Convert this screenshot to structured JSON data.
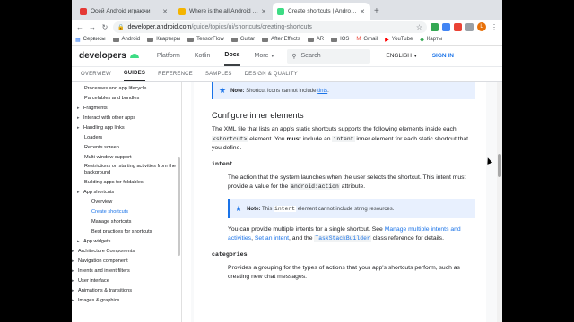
{
  "tabs": [
    {
      "title": "Осей Android играючи",
      "favicon_color": "#e53935",
      "active": false
    },
    {
      "title": "Where is the all Android broad",
      "favicon_color": "#f4b400",
      "active": false
    },
    {
      "title": "Create shortcuts | Android De",
      "favicon_color": "#3ddc84",
      "active": true
    }
  ],
  "toolbar": {
    "url_host": "developer.android.com",
    "url_path": "/guide/topics/ui/shortcuts/creating-shortcuts",
    "avatar_letter": "L"
  },
  "bookmarks": [
    {
      "label": "Сервисы",
      "icon": "apps-icon"
    },
    {
      "label": "Android",
      "icon": "folder-icon"
    },
    {
      "label": "Квартиры",
      "icon": "folder-icon"
    },
    {
      "label": "TensorFlow",
      "icon": "folder-icon"
    },
    {
      "label": "Guitar",
      "icon": "folder-icon"
    },
    {
      "label": "After Effects",
      "icon": "folder-icon"
    },
    {
      "label": "AR",
      "icon": "folder-icon"
    },
    {
      "label": "IOS",
      "icon": "folder-icon"
    },
    {
      "label": "Gmail",
      "icon": "gmail-icon"
    },
    {
      "label": "YouTube",
      "icon": "youtube-icon"
    },
    {
      "label": "Карты",
      "icon": "maps-icon"
    }
  ],
  "site": {
    "logo": "developers",
    "nav": [
      "Platform",
      "Kotlin",
      "Docs",
      "More"
    ],
    "search_placeholder": "Search",
    "language": "ENGLISH",
    "signin": "SIGN IN"
  },
  "subnav": [
    "OVERVIEW",
    "GUIDES",
    "REFERENCE",
    "SAMPLES",
    "DESIGN & QUALITY"
  ],
  "sidebar": [
    {
      "label": "Processes and app lifecycle",
      "chevron": false,
      "indent": 2
    },
    {
      "label": "Parcelables and bundles",
      "chevron": false,
      "indent": 2
    },
    {
      "label": "Fragments",
      "chevron": true,
      "indent": 1
    },
    {
      "label": "Interact with other apps",
      "chevron": true,
      "indent": 1
    },
    {
      "label": "Handling app links",
      "chevron": true,
      "indent": 1
    },
    {
      "label": "Loaders",
      "chevron": false,
      "indent": 2
    },
    {
      "label": "Recents screen",
      "chevron": false,
      "indent": 2
    },
    {
      "label": "Multi-window support",
      "chevron": false,
      "indent": 2
    },
    {
      "label": "Restrictions on starting activities from the background",
      "chevron": false,
      "indent": 2
    },
    {
      "label": "Building apps for foldables",
      "chevron": false,
      "indent": 2
    },
    {
      "label": "App shortcuts",
      "chevron": true,
      "indent": 1
    },
    {
      "label": "Overview",
      "chevron": false,
      "indent": 3
    },
    {
      "label": "Create shortcuts",
      "chevron": false,
      "indent": 3,
      "selected": true
    },
    {
      "label": "Manage shortcuts",
      "chevron": false,
      "indent": 3
    },
    {
      "label": "Best practices for shortcuts",
      "chevron": false,
      "indent": 3
    },
    {
      "label": "App widgets",
      "chevron": true,
      "indent": 1
    },
    {
      "label": "Architecture Components",
      "chevron": true,
      "indent": 0
    },
    {
      "label": "Navigation component",
      "chevron": true,
      "indent": 0
    },
    {
      "label": "Intents and intent filters",
      "chevron": true,
      "indent": 0
    },
    {
      "label": "User interface",
      "chevron": true,
      "indent": 0
    },
    {
      "label": "Animations & transitions",
      "chevron": true,
      "indent": 0
    },
    {
      "label": "Images & graphics",
      "chevron": true,
      "indent": 0
    }
  ],
  "article": {
    "note1_label": "Note:",
    "note1_text": "Shortcut icons cannot include",
    "note1_link": "tints",
    "heading": "Configure inner elements",
    "intro_1": "The XML file that lists an app's static shortcuts supports the following elements inside each",
    "intro_code1": "<shortcut>",
    "intro_2": "element. You",
    "intro_must": "must",
    "intro_3": "include an",
    "intro_code2": "intent",
    "intro_4": "inner element for each static shortcut that you define.",
    "term1": "intent",
    "term1_desc_1": "The action that the system launches when the user selects the shortcut. This intent must provide a value for the",
    "term1_desc_code": "android:action",
    "term1_desc_2": "attribute.",
    "note2_label": "Note:",
    "note2_pre": "This",
    "note2_code": "intent",
    "note2_post": "element cannot include string resources.",
    "multi_1": "You can provide multiple intents for a single shortcut. See",
    "multi_link1": "Manage multiple intents and activities",
    "multi_2": ",",
    "multi_link2": "Set an intent",
    "multi_3": ", and the",
    "multi_code": "TaskStackBuilder",
    "multi_4": "class reference for details.",
    "term2": "categories",
    "term2_desc": "Provides a grouping for the types of actions that your app's shortcuts perform, such as creating new chat messages."
  }
}
